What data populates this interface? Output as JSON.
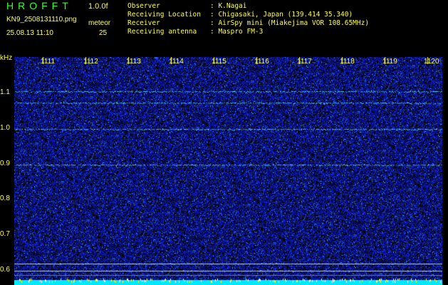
{
  "header": {
    "title": "HROFFT",
    "version": "1.0.0f",
    "filename": "KN9_2508131110.png",
    "mode": "meteor",
    "timestamp": "25.08.13 11:10",
    "count": "25",
    "fields": [
      {
        "label": "Observer",
        "value": ": K.Nagai"
      },
      {
        "label": "Receiving Location",
        "value": ": Chigasaki, Japan (139.414 35.340)"
      },
      {
        "label": "Receiver",
        "value": ": AirSpy mini (Miakejima VOR 108.65MHz)"
      },
      {
        "label": "Receiving antenna",
        "value": ": Maspro FM-3"
      }
    ]
  },
  "spectrogram": {
    "y_unit": "kHz",
    "y_ticks": [
      "1.1",
      "1.0",
      "0.9",
      "0.8",
      "0.7",
      "0.6"
    ],
    "x_ticks": [
      "1111",
      "1112",
      "1113",
      "1114",
      "1115",
      "1116",
      "1117",
      "1118",
      "1119",
      "1120"
    ],
    "colors": {
      "background": "#000000",
      "noise": "#1428c8",
      "signal": "#66ffff",
      "axis_labels": "#ffff44",
      "base_band": "#00ffff",
      "ticks": "#ffff00"
    }
  }
}
